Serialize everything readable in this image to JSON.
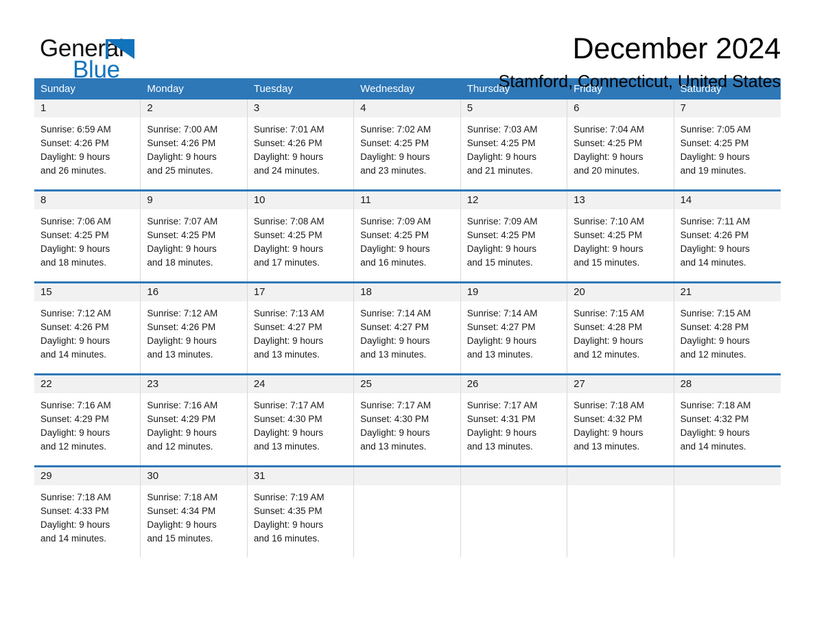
{
  "brand": {
    "name_part1": "General",
    "name_part2": "Blue",
    "logo_icon": "triangle-logo-icon",
    "accent_color": "#1273bd"
  },
  "header": {
    "month_title": "December 2024",
    "location": "Stamford, Connecticut, United States"
  },
  "colors": {
    "header_blue": "#2e78b8",
    "day_band_gray": "#f1f1f1",
    "cell_border": "#d7d7d7"
  },
  "weekdays": [
    "Sunday",
    "Monday",
    "Tuesday",
    "Wednesday",
    "Thursday",
    "Friday",
    "Saturday"
  ],
  "weeks": [
    {
      "days": [
        {
          "number": "1",
          "sunrise": "Sunrise: 6:59 AM",
          "sunset": "Sunset: 4:26 PM",
          "daylight_line1": "Daylight: 9 hours",
          "daylight_line2": "and 26 minutes."
        },
        {
          "number": "2",
          "sunrise": "Sunrise: 7:00 AM",
          "sunset": "Sunset: 4:26 PM",
          "daylight_line1": "Daylight: 9 hours",
          "daylight_line2": "and 25 minutes."
        },
        {
          "number": "3",
          "sunrise": "Sunrise: 7:01 AM",
          "sunset": "Sunset: 4:26 PM",
          "daylight_line1": "Daylight: 9 hours",
          "daylight_line2": "and 24 minutes."
        },
        {
          "number": "4",
          "sunrise": "Sunrise: 7:02 AM",
          "sunset": "Sunset: 4:25 PM",
          "daylight_line1": "Daylight: 9 hours",
          "daylight_line2": "and 23 minutes."
        },
        {
          "number": "5",
          "sunrise": "Sunrise: 7:03 AM",
          "sunset": "Sunset: 4:25 PM",
          "daylight_line1": "Daylight: 9 hours",
          "daylight_line2": "and 21 minutes."
        },
        {
          "number": "6",
          "sunrise": "Sunrise: 7:04 AM",
          "sunset": "Sunset: 4:25 PM",
          "daylight_line1": "Daylight: 9 hours",
          "daylight_line2": "and 20 minutes."
        },
        {
          "number": "7",
          "sunrise": "Sunrise: 7:05 AM",
          "sunset": "Sunset: 4:25 PM",
          "daylight_line1": "Daylight: 9 hours",
          "daylight_line2": "and 19 minutes."
        }
      ]
    },
    {
      "days": [
        {
          "number": "8",
          "sunrise": "Sunrise: 7:06 AM",
          "sunset": "Sunset: 4:25 PM",
          "daylight_line1": "Daylight: 9 hours",
          "daylight_line2": "and 18 minutes."
        },
        {
          "number": "9",
          "sunrise": "Sunrise: 7:07 AM",
          "sunset": "Sunset: 4:25 PM",
          "daylight_line1": "Daylight: 9 hours",
          "daylight_line2": "and 18 minutes."
        },
        {
          "number": "10",
          "sunrise": "Sunrise: 7:08 AM",
          "sunset": "Sunset: 4:25 PM",
          "daylight_line1": "Daylight: 9 hours",
          "daylight_line2": "and 17 minutes."
        },
        {
          "number": "11",
          "sunrise": "Sunrise: 7:09 AM",
          "sunset": "Sunset: 4:25 PM",
          "daylight_line1": "Daylight: 9 hours",
          "daylight_line2": "and 16 minutes."
        },
        {
          "number": "12",
          "sunrise": "Sunrise: 7:09 AM",
          "sunset": "Sunset: 4:25 PM",
          "daylight_line1": "Daylight: 9 hours",
          "daylight_line2": "and 15 minutes."
        },
        {
          "number": "13",
          "sunrise": "Sunrise: 7:10 AM",
          "sunset": "Sunset: 4:25 PM",
          "daylight_line1": "Daylight: 9 hours",
          "daylight_line2": "and 15 minutes."
        },
        {
          "number": "14",
          "sunrise": "Sunrise: 7:11 AM",
          "sunset": "Sunset: 4:26 PM",
          "daylight_line1": "Daylight: 9 hours",
          "daylight_line2": "and 14 minutes."
        }
      ]
    },
    {
      "days": [
        {
          "number": "15",
          "sunrise": "Sunrise: 7:12 AM",
          "sunset": "Sunset: 4:26 PM",
          "daylight_line1": "Daylight: 9 hours",
          "daylight_line2": "and 14 minutes."
        },
        {
          "number": "16",
          "sunrise": "Sunrise: 7:12 AM",
          "sunset": "Sunset: 4:26 PM",
          "daylight_line1": "Daylight: 9 hours",
          "daylight_line2": "and 13 minutes."
        },
        {
          "number": "17",
          "sunrise": "Sunrise: 7:13 AM",
          "sunset": "Sunset: 4:27 PM",
          "daylight_line1": "Daylight: 9 hours",
          "daylight_line2": "and 13 minutes."
        },
        {
          "number": "18",
          "sunrise": "Sunrise: 7:14 AM",
          "sunset": "Sunset: 4:27 PM",
          "daylight_line1": "Daylight: 9 hours",
          "daylight_line2": "and 13 minutes."
        },
        {
          "number": "19",
          "sunrise": "Sunrise: 7:14 AM",
          "sunset": "Sunset: 4:27 PM",
          "daylight_line1": "Daylight: 9 hours",
          "daylight_line2": "and 13 minutes."
        },
        {
          "number": "20",
          "sunrise": "Sunrise: 7:15 AM",
          "sunset": "Sunset: 4:28 PM",
          "daylight_line1": "Daylight: 9 hours",
          "daylight_line2": "and 12 minutes."
        },
        {
          "number": "21",
          "sunrise": "Sunrise: 7:15 AM",
          "sunset": "Sunset: 4:28 PM",
          "daylight_line1": "Daylight: 9 hours",
          "daylight_line2": "and 12 minutes."
        }
      ]
    },
    {
      "days": [
        {
          "number": "22",
          "sunrise": "Sunrise: 7:16 AM",
          "sunset": "Sunset: 4:29 PM",
          "daylight_line1": "Daylight: 9 hours",
          "daylight_line2": "and 12 minutes."
        },
        {
          "number": "23",
          "sunrise": "Sunrise: 7:16 AM",
          "sunset": "Sunset: 4:29 PM",
          "daylight_line1": "Daylight: 9 hours",
          "daylight_line2": "and 12 minutes."
        },
        {
          "number": "24",
          "sunrise": "Sunrise: 7:17 AM",
          "sunset": "Sunset: 4:30 PM",
          "daylight_line1": "Daylight: 9 hours",
          "daylight_line2": "and 13 minutes."
        },
        {
          "number": "25",
          "sunrise": "Sunrise: 7:17 AM",
          "sunset": "Sunset: 4:30 PM",
          "daylight_line1": "Daylight: 9 hours",
          "daylight_line2": "and 13 minutes."
        },
        {
          "number": "26",
          "sunrise": "Sunrise: 7:17 AM",
          "sunset": "Sunset: 4:31 PM",
          "daylight_line1": "Daylight: 9 hours",
          "daylight_line2": "and 13 minutes."
        },
        {
          "number": "27",
          "sunrise": "Sunrise: 7:18 AM",
          "sunset": "Sunset: 4:32 PM",
          "daylight_line1": "Daylight: 9 hours",
          "daylight_line2": "and 13 minutes."
        },
        {
          "number": "28",
          "sunrise": "Sunrise: 7:18 AM",
          "sunset": "Sunset: 4:32 PM",
          "daylight_line1": "Daylight: 9 hours",
          "daylight_line2": "and 14 minutes."
        }
      ]
    },
    {
      "days": [
        {
          "number": "29",
          "sunrise": "Sunrise: 7:18 AM",
          "sunset": "Sunset: 4:33 PM",
          "daylight_line1": "Daylight: 9 hours",
          "daylight_line2": "and 14 minutes."
        },
        {
          "number": "30",
          "sunrise": "Sunrise: 7:18 AM",
          "sunset": "Sunset: 4:34 PM",
          "daylight_line1": "Daylight: 9 hours",
          "daylight_line2": "and 15 minutes."
        },
        {
          "number": "31",
          "sunrise": "Sunrise: 7:19 AM",
          "sunset": "Sunset: 4:35 PM",
          "daylight_line1": "Daylight: 9 hours",
          "daylight_line2": "and 16 minutes."
        },
        {
          "number": "",
          "sunrise": "",
          "sunset": "",
          "daylight_line1": "",
          "daylight_line2": ""
        },
        {
          "number": "",
          "sunrise": "",
          "sunset": "",
          "daylight_line1": "",
          "daylight_line2": ""
        },
        {
          "number": "",
          "sunrise": "",
          "sunset": "",
          "daylight_line1": "",
          "daylight_line2": ""
        },
        {
          "number": "",
          "sunrise": "",
          "sunset": "",
          "daylight_line1": "",
          "daylight_line2": ""
        }
      ]
    }
  ]
}
